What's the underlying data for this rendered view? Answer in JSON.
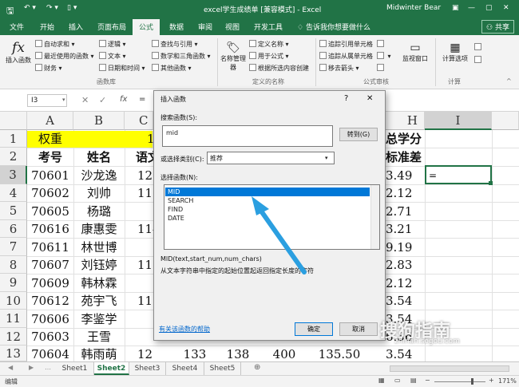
{
  "window": {
    "title": "excel学生成绩单 [兼容模式] - Excel",
    "user": "Midwinter Bear"
  },
  "tabs": [
    "文件",
    "开始",
    "插入",
    "页面布局",
    "公式",
    "数据",
    "审阅",
    "视图",
    "开发工具",
    "告诉我你想要做什么"
  ],
  "share_label": "共享",
  "ribbon": {
    "insert_function": "插入函数",
    "lib_col1": [
      "自动求和 ▾",
      "最近使用的函数 ▾",
      "财务 ▾"
    ],
    "lib_col2": [
      "逻辑 ▾",
      "文本 ▾",
      "日期和时间 ▾"
    ],
    "lib_col3": [
      "查找与引用 ▾",
      "数学和三角函数 ▾",
      "其他函数 ▾"
    ],
    "lib_group": "函数库",
    "name_manager": "名称管理器",
    "names_items": [
      "定义名称 ▾",
      "用于公式 ▾",
      "根据所选内容创建"
    ],
    "names_group": "定义的名称",
    "audit_items": [
      "追踪引用单元格",
      "追踪从属单元格",
      "移去箭头 ▾"
    ],
    "audit_group": "公式审核",
    "watch_window": "监视窗口",
    "calc_options": "计算选项",
    "calc_group": "计算"
  },
  "formula_bar": {
    "name_box": "I3",
    "fx": "fx",
    "content": "="
  },
  "columns": [
    "A",
    "B",
    "C",
    "H",
    "I"
  ],
  "rows": [
    "1",
    "2",
    "3",
    "4",
    "5",
    "6",
    "7",
    "8",
    "9",
    "10",
    "11",
    "12",
    "13"
  ],
  "sheet_cells": {
    "r1": [
      "权重",
      "",
      "1"
    ],
    "r2": [
      "考号",
      "姓名",
      "语文"
    ],
    "ids": [
      "70601",
      "70602",
      "70605",
      "70616",
      "70611",
      "70607",
      "70609",
      "70612",
      "70606",
      "70603",
      "70604"
    ],
    "names": [
      "沙龙逸",
      "刘帅",
      "杨璐",
      "康惠雯",
      "林世博",
      "刘钰婷",
      "韩林霖",
      "苑宇飞",
      "李鉴学",
      "王雪",
      "韩雨萌"
    ],
    "c_vals": [
      "123",
      "116",
      "",
      "114",
      "",
      "115",
      "",
      "118",
      "",
      "",
      "129"
    ],
    "h1": "总学分",
    "h2": "标准差",
    "h_vals": [
      "3.49",
      "2.12",
      "2.71",
      "3.21",
      "9.19",
      "2.83",
      "2.12",
      "3.54",
      "3.54",
      "6.36",
      "3.54"
    ],
    "i3": "=",
    "r13_extra": [
      "133",
      "138",
      "400",
      "135.50"
    ]
  },
  "dialog": {
    "title": "插入函数",
    "help": "?",
    "close": "✕",
    "search_label": "搜索函数(S):",
    "search_value": "mid",
    "go_button": "转到(G)",
    "category_label": "或选择类别(C):",
    "category_value": "推荐",
    "select_label": "选择函数(N):",
    "functions": [
      "MID",
      "SEARCH",
      "FIND",
      "DATE"
    ],
    "signature": "MID(text,start_num,num_chars)",
    "description": "从文本字符串中指定的起始位置起返回指定长度的字符",
    "help_link": "有关该函数的帮助",
    "ok": "确定",
    "cancel": "取消"
  },
  "sheet_tabs": [
    "Sheet1",
    "Sheet2",
    "Sheet3",
    "Sheet4",
    "Sheet5"
  ],
  "active_sheet": "Sheet2",
  "status": {
    "mode": "编辑",
    "zoom": "171%"
  },
  "watermark": {
    "brand": "搜狗指南",
    "url": "zhinan.sogou.com"
  },
  "colors": {
    "excel_green": "#217346",
    "highlight_yellow": "#ffff00",
    "selection_blue": "#0078d7",
    "arrow_blue": "#2b9fe0"
  }
}
